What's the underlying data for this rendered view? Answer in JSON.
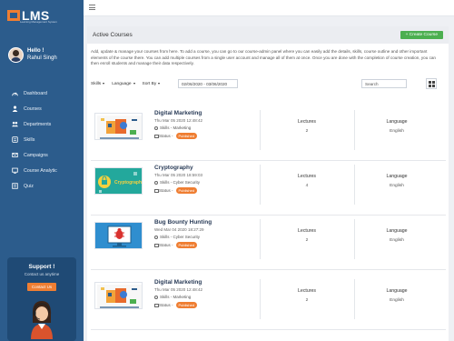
{
  "app": {
    "logo_text": "LMS",
    "logo_sub": "Learning Management System"
  },
  "user": {
    "greeting": "Hello !",
    "name": "Rahul Singh"
  },
  "sidebar": {
    "items": [
      {
        "label": "Dashboard",
        "icon": "dashboard-icon"
      },
      {
        "label": "Courses",
        "icon": "courses-icon"
      },
      {
        "label": "Departments",
        "icon": "departments-icon"
      },
      {
        "label": "Skills",
        "icon": "skills-icon"
      },
      {
        "label": "Campaigns",
        "icon": "campaigns-icon"
      },
      {
        "label": "Course Analytic",
        "icon": "analytics-icon"
      },
      {
        "label": "Quiz",
        "icon": "quiz-icon"
      }
    ]
  },
  "support": {
    "title": "Support !",
    "subtitle": "Contact us anytime",
    "button": "Contact Us"
  },
  "main": {
    "title": "Active Courses",
    "create_button": "+ Create Course",
    "description": "Add, update & manage your courses from here. To add a course, you can go to our course-admin panel where you can easily add the details, skills, course outline and other important elements of the course there. You can add multiple courses from a single user account and manage all of them at once. Once you are done with the completion of course creation, you can then enroll students and manage their data respectively."
  },
  "filters": {
    "skills": "Skills",
    "language": "Language",
    "sort": "Sort By",
    "date_range": "02/06/2020 - 03/06/2020",
    "search_placeholder": "Search"
  },
  "columns": {
    "lectures": "Lectures",
    "language": "Language"
  },
  "courses": [
    {
      "title": "Digital Marketing",
      "date": "Thu Mar 05 2020 12:48:42",
      "skills": "Skills - Marketing",
      "status_label": "Status -",
      "status": "Published",
      "lectures": "2",
      "language": "English",
      "thumb": "digital-marketing"
    },
    {
      "title": "Cryptography",
      "date": "Thu Mar 05 2020 18:59:03",
      "skills": "Skills - Cyber Security",
      "status_label": "Status -",
      "status": "Published",
      "lectures": "4",
      "language": "English",
      "thumb": "cryptography"
    },
    {
      "title": "Bug Bounty Hunting",
      "date": "Wed Mar 04 2020 18:27:29",
      "skills": "Skills - Cyber Security",
      "status_label": "Status -",
      "status": "Published",
      "lectures": "2",
      "language": "English",
      "thumb": "bug-bounty"
    },
    {
      "title": "Digital Marketing",
      "date": "Thu Mar 05 2020 12:48:42",
      "skills": "Skills - Marketing",
      "status_label": "Status -",
      "status": "Published",
      "lectures": "2",
      "language": "English",
      "thumb": "digital-marketing"
    }
  ],
  "colors": {
    "sidebar": "#2c5c8c",
    "accent": "#ef7e32",
    "create": "#4caf50"
  }
}
